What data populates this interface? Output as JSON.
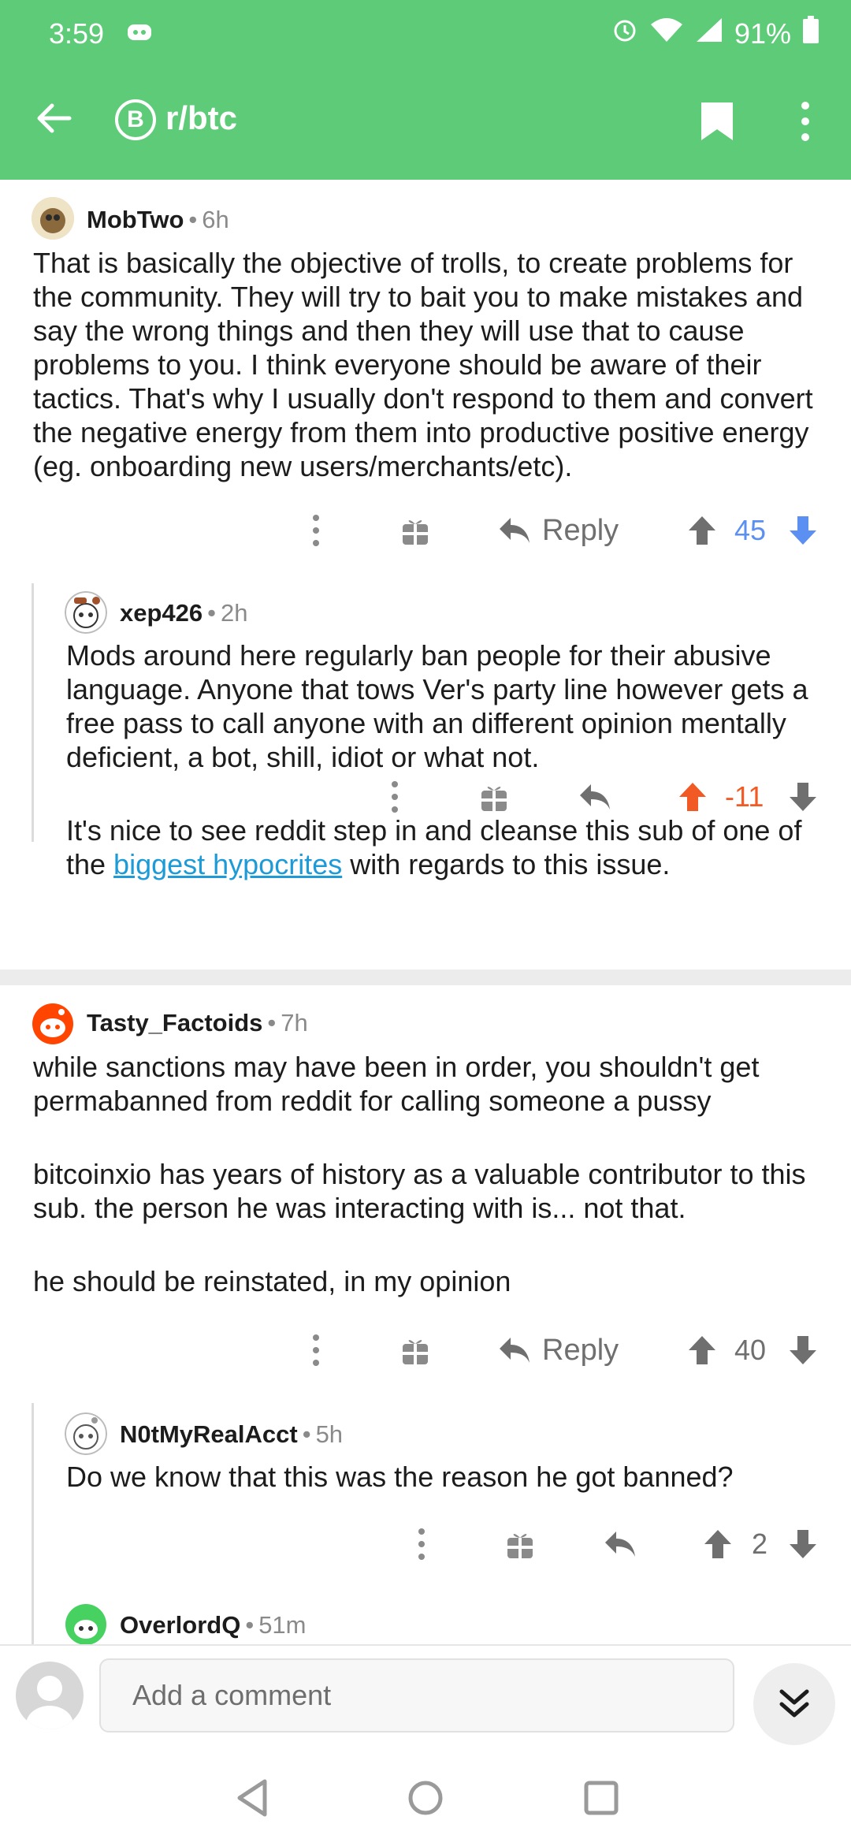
{
  "status_bar": {
    "time": "3:59",
    "battery": "91%"
  },
  "toolbar": {
    "subreddit": "r/btc",
    "subreddit_icon_glyph": "B"
  },
  "reply_label": "Reply",
  "comments": [
    {
      "author": "MobTwo",
      "age": "6h",
      "paragraphs": [
        "That is basically the objective of trolls, to create problems for the community. They will try to bait you to make mistakes and say the wrong things and then they will use that to cause problems to you. I think everyone should be aware of their tactics. That's why I usually don't respond to them and convert the negative energy from them into productive positive energy (eg. onboarding new users/merchants/etc)."
      ],
      "score": "45",
      "vote": "downvoted"
    },
    {
      "author": "xep426",
      "age": "2h",
      "paragraphs": [
        "Mods around here regularly ban people for their abusive language. Anyone that tows Ver's party line however gets a free pass to call anyone with an different opinion mentally deficient, a bot, shill, idiot or what not."
      ],
      "p2_before": "It's nice to see reddit step in and cleanse this sub of one of the ",
      "p2_link": "biggest hypocrites",
      "p2_after": " with regards to this issue.",
      "score": "-11",
      "vote": "upvoted"
    },
    {
      "author": "Tasty_Factoids",
      "age": "7h",
      "paragraphs": [
        "while sanctions may have been in order, you shouldn't get permabanned from reddit for calling someone a pussy",
        "bitcoinxio has years of history as a valuable contributor to this sub.  the person he was interacting with is... not that.",
        "he should be reinstated, in my opinion"
      ],
      "score": "40",
      "vote": "none"
    },
    {
      "author": "N0tMyRealAcct",
      "age": "5h",
      "paragraphs": [
        "Do we know that this was the reason he got banned?"
      ],
      "score": "2",
      "vote": "none"
    },
    {
      "author": "OverlordQ",
      "age": "51m"
    }
  ],
  "composer": {
    "placeholder": "Add a comment"
  },
  "colors": {
    "header": "#5ecb78",
    "upvote": "#f15a24",
    "downvote": "#5b8ff1",
    "link": "#1e9bd7"
  }
}
